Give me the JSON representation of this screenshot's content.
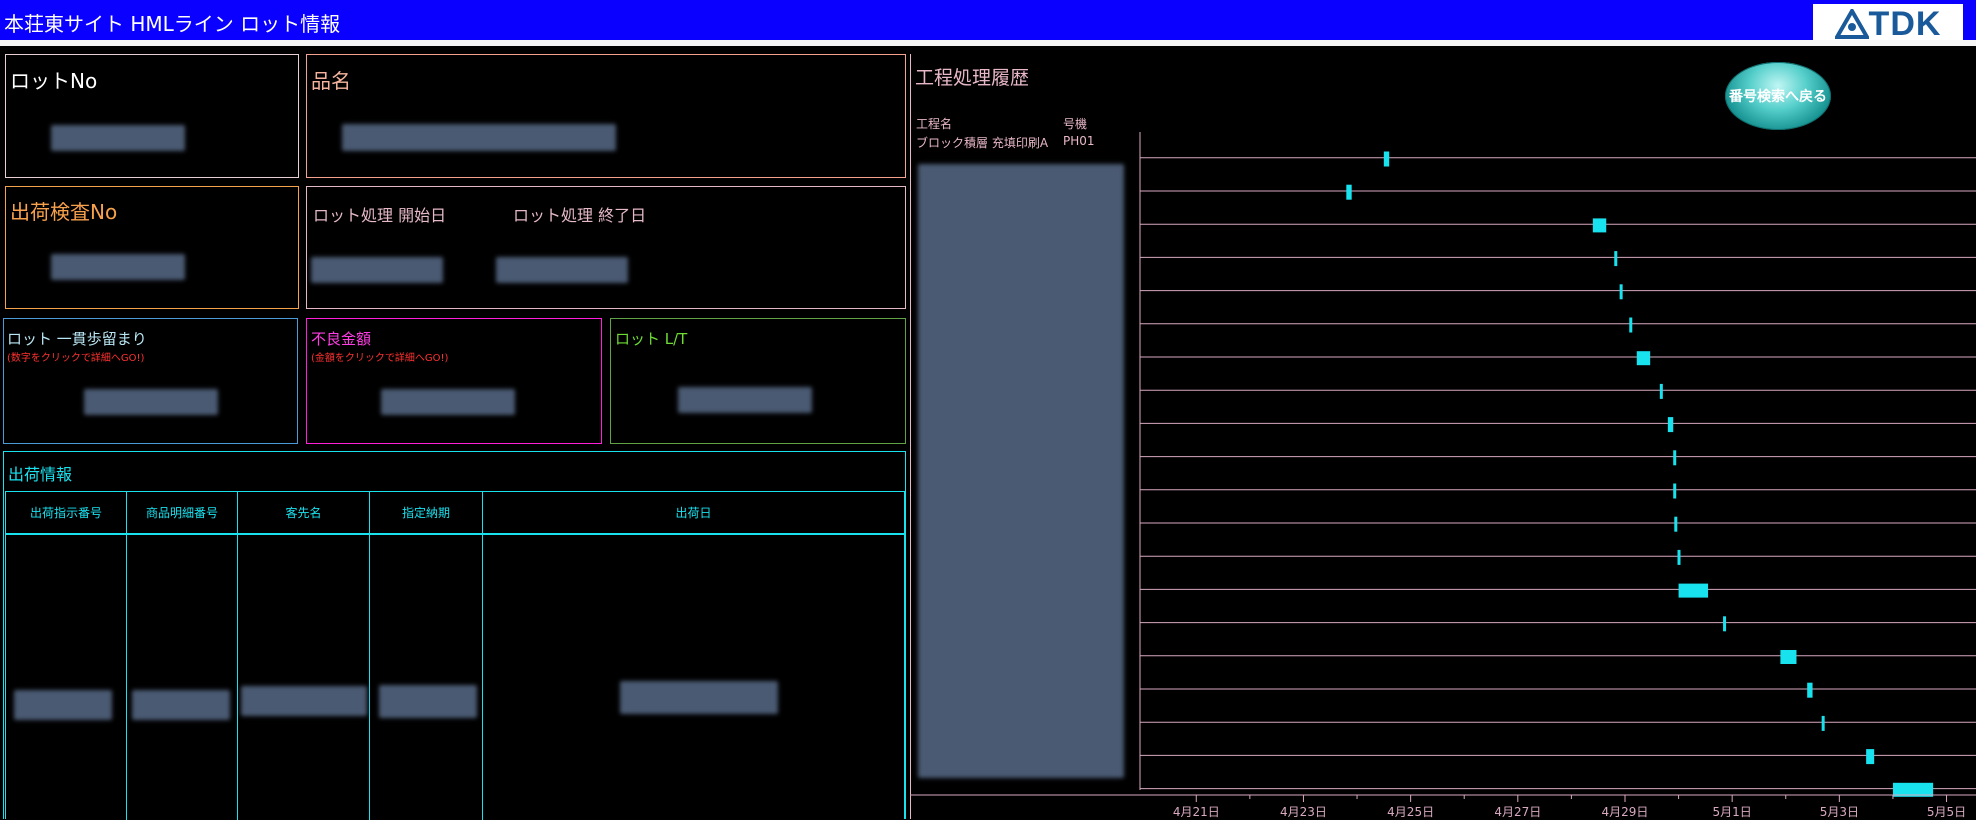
{
  "header": {
    "title": "本荘東サイト HMLライン ロット情報",
    "logo": "TDK",
    "logo_icon": "tdk-mark-icon"
  },
  "lot_no": {
    "label": "ロットNo"
  },
  "product_name": {
    "label": "品名"
  },
  "shipment_inspection": {
    "label": "出荷検査No"
  },
  "lot_processing": {
    "start_label": "ロット処理 開始日",
    "end_label": "ロット処理 終了日"
  },
  "yield": {
    "label": "ロット 一貫歩留まり",
    "hint": "(数字をクリックで詳細へGO!)"
  },
  "defect": {
    "label": "不良金額",
    "hint": "(金額をクリックで詳細へGO!)"
  },
  "lead_time": {
    "label": "ロット L/T"
  },
  "shipping": {
    "title": "出荷情報",
    "columns": [
      "出荷指示番号",
      "商品明細番号",
      "客先名",
      "指定納期",
      "出荷日"
    ]
  },
  "process_history": {
    "title": "工程処理履歴",
    "back_button": "番号検索へ戻る",
    "col_process": "工程名",
    "col_machine": "号機",
    "first_process": "ブロック積層 充填印刷A",
    "first_machine": "PH01"
  },
  "chart_data": {
    "type": "gantt",
    "title": "工程処理履歴",
    "x_tick_labels": [
      "4月21日",
      "4月23日",
      "4月25日",
      "4月27日",
      "4月29日",
      "5月1日",
      "5月3日",
      "5月5日"
    ],
    "x_start_label": "4月21日",
    "xlim_days": [
      -1.05,
      14.55
    ],
    "bars": [
      {
        "start": 3.5,
        "end": 3.6
      },
      {
        "start": 2.8,
        "end": 2.9
      },
      {
        "start": 7.4,
        "end": 7.65
      },
      {
        "start": 7.8,
        "end": 7.85
      },
      {
        "start": 7.9,
        "end": 7.95
      },
      {
        "start": 8.08,
        "end": 8.13
      },
      {
        "start": 8.22,
        "end": 8.47
      },
      {
        "start": 8.65,
        "end": 8.7
      },
      {
        "start": 8.8,
        "end": 8.9
      },
      {
        "start": 8.9,
        "end": 8.95
      },
      {
        "start": 8.9,
        "end": 8.95
      },
      {
        "start": 8.92,
        "end": 8.97
      },
      {
        "start": 8.98,
        "end": 9.03
      },
      {
        "start": 9.0,
        "end": 9.55
      },
      {
        "start": 9.83,
        "end": 9.88
      },
      {
        "start": 10.9,
        "end": 11.2
      },
      {
        "start": 11.4,
        "end": 11.5
      },
      {
        "start": 11.67,
        "end": 11.72
      },
      {
        "start": 12.5,
        "end": 12.65
      },
      {
        "start": 13.0,
        "end": 13.75
      }
    ],
    "colors": {
      "bar": "#19e2ef",
      "row_line": "#d8a8c0",
      "axis_text": "#d8a8c0"
    }
  }
}
